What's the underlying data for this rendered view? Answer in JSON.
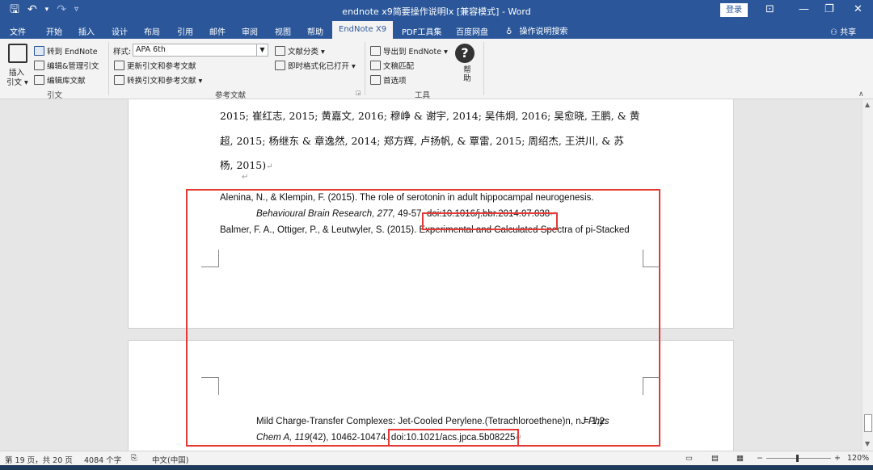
{
  "titlebar": {
    "title": "endnote x9简要操作说明lx [兼容模式] - Word",
    "login": "登录",
    "qat": {
      "save": "🖫",
      "undo": "↶",
      "undo_dd": "▾",
      "redo": "↷",
      "customize": "▿"
    },
    "window": {
      "ribbon_options": "⊡",
      "minimize": "—",
      "restore": "❐",
      "close": "✕"
    }
  },
  "tabs": [
    {
      "label": "文件"
    },
    {
      "label": "开始"
    },
    {
      "label": "插入"
    },
    {
      "label": "设计"
    },
    {
      "label": "布局"
    },
    {
      "label": "引用"
    },
    {
      "label": "邮件"
    },
    {
      "label": "审阅"
    },
    {
      "label": "视图"
    },
    {
      "label": "帮助"
    },
    {
      "label": "EndNote X9"
    },
    {
      "label": "PDF工具集"
    },
    {
      "label": "百度网盘"
    }
  ],
  "tellme": "操作说明搜索",
  "share": "共享",
  "ribbon": {
    "insert_citation": "插入",
    "insert_citation2": "引文 ▾",
    "goto_endnote": "转到 EndNote",
    "edit_manage": "编辑&管理引文",
    "edit_library": "编辑库文献",
    "group_citations": "引文",
    "style_label": "样式:",
    "style_value": "APA 6th",
    "update": "更新引文和参考文献",
    "convert": "转换引文和参考文献 ▾",
    "categorize": "文献分类 ▾",
    "instant": "即时格式化已打开 ▾",
    "group_bibliography": "参考文献",
    "export": "导出到 EndNote ▾",
    "manuscript": "文稿匹配",
    "preferences": "首选项",
    "group_tools": "工具",
    "help_label": "帮助",
    "help_icon": "?"
  },
  "document": {
    "cn_line1": "2015; 崔红志, 2015; 黄嘉文, 2016; 穆峥 & 谢宇, 2014; 吴伟炯, 2016; 吴愈晓, 王鹏, & 黄",
    "cn_line2": "超, 2015; 杨继东 & 章逸然, 2014; 郑方辉, 卢扬帆, & 覃雷, 2015; 周绍杰, 王洪川, & 苏",
    "cn_line3": "杨, 2015)",
    "para_mark": "↵",
    "ref1_line1": "Alenina, N., & Klempin, F. (2015). The role of serotonin in adult hippocampal neurogenesis.",
    "ref1_journal": "Behavioural Brain Research, 277,",
    "ref1_pages": " 49-57. ",
    "ref1_doi": "doi:10.1016/j.bbr.2014.07.038",
    "ref2_line1": "Balmer, F. A., Ottiger, P., & Leutwyler, S. (2015). Experimental and Calculated Spectra of pi-Stacked",
    "ref2_line2": "Mild Charge-Transfer Complexes: Jet-Cooled Perylene.(Tetrachloroethene)n, n = 1,2. ",
    "ref2_journal": "J Phys",
    "ref2_journal2": "Chem A, 119",
    "ref2_issue": "(42), 10462-10474. ",
    "ref2_doi": "doi:10.1021/acs.jpca.5b08225"
  },
  "status": {
    "page": "第 19 页，共 20 页",
    "words": "4084 个字",
    "language": "中文(中国)",
    "zoom": "120%",
    "zoom_minus": "−",
    "zoom_plus": "+"
  },
  "colors": {
    "brand": "#2b579a",
    "highlight": "#e53935"
  }
}
